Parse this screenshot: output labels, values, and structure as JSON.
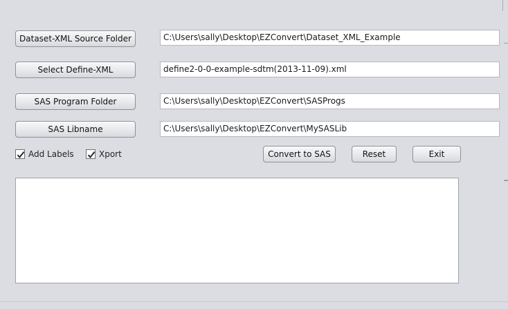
{
  "buttons": {
    "dataset_xml_source_folder": "Dataset-XML Source Folder",
    "select_define_xml": "Select Define-XML",
    "sas_program_folder": "SAS Program Folder",
    "sas_libname": "SAS Libname",
    "convert_to_sas": "Convert to SAS",
    "reset": "Reset",
    "exit": "Exit"
  },
  "fields": {
    "dataset_xml_source_folder": "C:\\Users\\sally\\Desktop\\EZConvert\\Dataset_XML_Example",
    "define_xml": "define2-0-0-example-sdtm(2013-11-09).xml",
    "sas_program_folder": "C:\\Users\\sally\\Desktop\\EZConvert\\SASProgs",
    "sas_libname": "C:\\Users\\sally\\Desktop\\EZConvert\\MySASLib"
  },
  "checkboxes": {
    "add_labels": {
      "label": "Add Labels",
      "checked": true
    },
    "xport": {
      "label": "Xport",
      "checked": true
    }
  },
  "output": {
    "text": ""
  },
  "icons": {
    "checkmark": "checkmark-icon"
  }
}
